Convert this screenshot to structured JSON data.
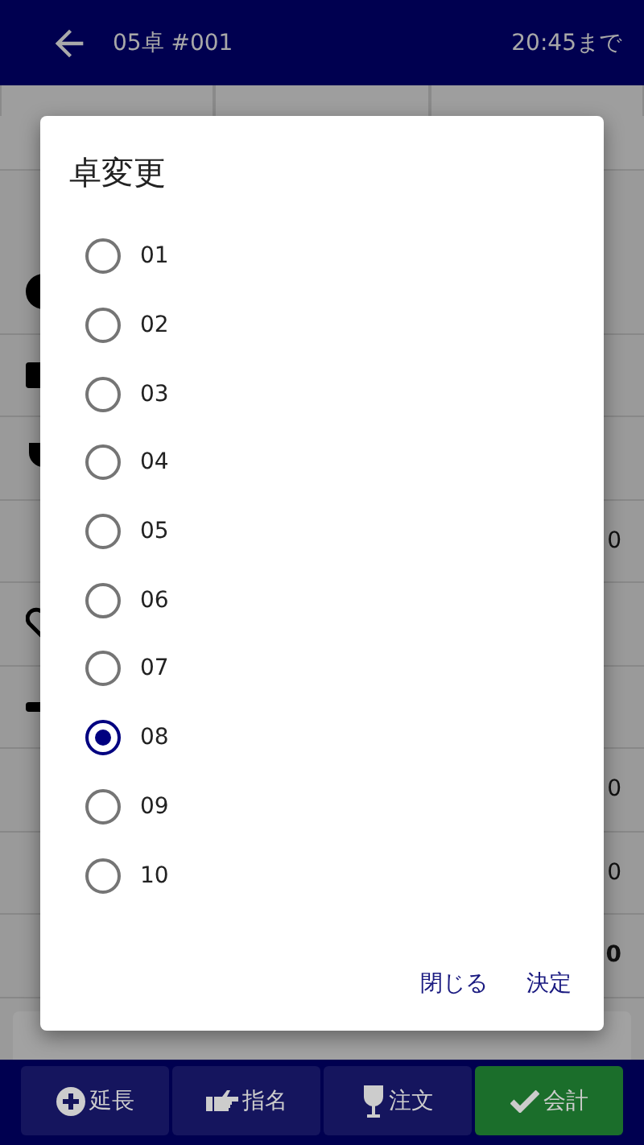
{
  "header": {
    "title": "05卓 #001",
    "until": "20:45まで"
  },
  "rows": [
    {
      "kind": "circle"
    },
    {
      "kind": "card"
    },
    {
      "kind": "cup"
    },
    {
      "value": "0"
    },
    {
      "kind": "heart"
    },
    {
      "kind": "dash"
    },
    {
      "value": "0"
    },
    {
      "value": "0"
    },
    {
      "value": "0",
      "bold": true
    }
  ],
  "dialog": {
    "title": "卓変更",
    "options": [
      {
        "label": "01",
        "selected": false
      },
      {
        "label": "02",
        "selected": false
      },
      {
        "label": "03",
        "selected": false
      },
      {
        "label": "04",
        "selected": false
      },
      {
        "label": "05",
        "selected": false
      },
      {
        "label": "06",
        "selected": false
      },
      {
        "label": "07",
        "selected": false
      },
      {
        "label": "08",
        "selected": true
      },
      {
        "label": "09",
        "selected": false
      },
      {
        "label": "10",
        "selected": false
      }
    ],
    "actions": [
      "閉じる",
      "決定"
    ]
  },
  "bottom_bar": [
    {
      "label": "延長",
      "kind": "plus",
      "primary": false
    },
    {
      "label": "指名",
      "kind": "hand",
      "primary": false
    },
    {
      "label": "注文",
      "kind": "glass",
      "primary": false
    },
    {
      "label": "会計",
      "kind": "check",
      "primary": true
    }
  ]
}
